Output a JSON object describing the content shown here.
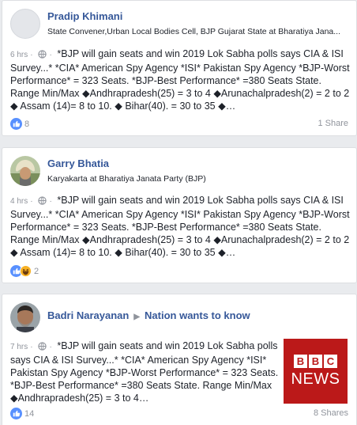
{
  "posts": [
    {
      "author": "Pradip Khimani",
      "subtitle": "State Convener,Urban Local Bodies Cell, BJP Gujarat State at Bharatiya Jana...",
      "time": "6 hrs",
      "text": "*BJP will gain seats and win 2019 Lok Sabha polls says CIA & ISI Survey...* *CIA* American Spy Agency *ISI* Pakistan Spy Agency *BJP-Worst Performance* = 323 Seats. *BJP-Best Performance* =380 Seats State. Range Min/Max ◆Andhrapradesh(25) = 3 to 4 ◆Arunachalpradesh(2) = 2 to 2 ◆ Assam (14)= 8 to 10. ◆ Bihar(40). = 30 to 35 ◆…",
      "reactions": "8",
      "shares": "1 Share",
      "reaction_icons": [
        "like-icon"
      ]
    },
    {
      "author": "Garry Bhatia",
      "subtitle": "Karyakarta at Bharatiya Janata Party (BJP)",
      "time": "4 hrs",
      "text": "*BJP will gain seats and win 2019 Lok Sabha polls says CIA & ISI Survey...* *CIA* American Spy Agency *ISI* Pakistan Spy Agency *BJP-Worst Performance* = 323 Seats. *BJP-Best Performance* =380 Seats State. Range Min/Max ◆Andhrapradesh(25) = 3 to 4 ◆Arunachalpradesh(2) = 2 to 2 ◆ Assam (14)= 8 to 10. ◆ Bihar(40). = 30 to 35 ◆…",
      "reactions": "2",
      "shares": "",
      "reaction_icons": [
        "like-icon",
        "haha-icon"
      ]
    },
    {
      "author": "Badri Narayanan",
      "group": "Nation wants to know",
      "time": "7 hrs",
      "text": "*BJP will gain seats and win 2019 Lok Sabha polls says CIA & ISI Survey...* *CIA* American Spy Agency *ISI* Pakistan Spy Agency *BJP-Worst Performance* = 323 Seats. *BJP-Best Performance* =380 Seats State. Range Min/Max ◆Andhrapradesh(25) = 3 to 4…",
      "reactions": "14",
      "shares": "8 Shares",
      "reaction_icons": [
        "like-icon"
      ],
      "thumbnail": {
        "brand": [
          "B",
          "B",
          "C"
        ],
        "word": "NEWS"
      }
    }
  ],
  "colors": {
    "link": "#365899",
    "like": "#5890ff",
    "haha": "#f7b125",
    "bbc_red": "#bb1919"
  }
}
